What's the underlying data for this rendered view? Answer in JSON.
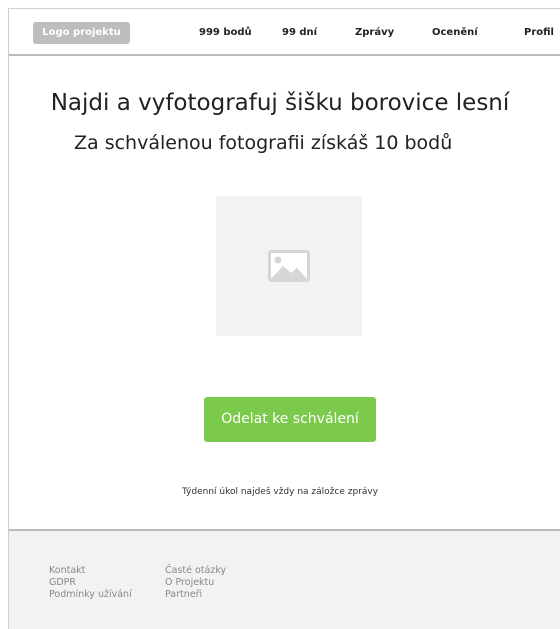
{
  "header": {
    "logo": "Logo projektu",
    "points": "999 bodů",
    "days": "99 dní",
    "messages": "Zprávy",
    "awards": "Ocenění",
    "profile": "Profil"
  },
  "main": {
    "title": "Najdi a vyfotografuj šišku borovice lesní",
    "subtitle": "Za schválenou fotografii získáš 10 bodů",
    "image_icon": "image-icon",
    "submit_label": "Odelat ke schválení",
    "hint": "Týdenní úkol najdeš vždy na záložce zprávy"
  },
  "footer": {
    "col1": [
      "Kontakt",
      "GDPR",
      "Podmínky užívání"
    ],
    "col2": [
      "Časté otázky",
      "O Projektu",
      "Partneři"
    ]
  },
  "colors": {
    "accent": "#7cca4c",
    "logo_bg": "#bdbdbd",
    "footer_bg": "#f2f2f2"
  }
}
